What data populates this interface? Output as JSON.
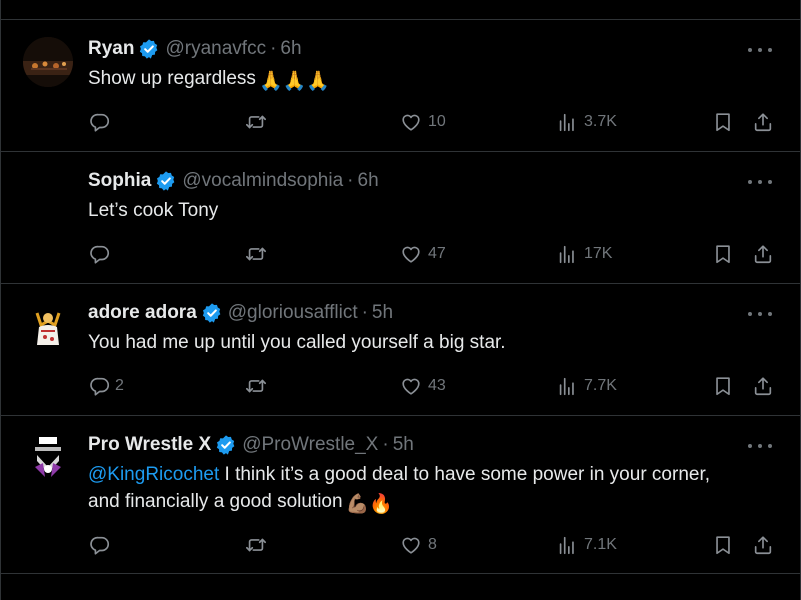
{
  "tweets": [
    {
      "name": "Ryan",
      "handle": "@ryanavfcc",
      "sep": "·",
      "time": "6h",
      "text": "Show up regardless",
      "emoji": "🙏🙏🙏",
      "replies": "",
      "likes": "10",
      "views": "3.7K"
    },
    {
      "name": "Sophia",
      "handle": "@vocalmindsophia",
      "sep": "·",
      "time": "6h",
      "text": "Let’s cook Tony",
      "replies": "",
      "likes": "47",
      "views": "17K"
    },
    {
      "name": "adore adora",
      "handle": "@gloriousafflict",
      "sep": "·",
      "time": "5h",
      "text": "You had me up until you called yourself a big star.",
      "replies": "2",
      "likes": "43",
      "views": "7.7K"
    },
    {
      "name": "Pro Wrestle X",
      "handle": "@ProWrestle_X",
      "sep": "·",
      "time": "5h",
      "mention": "@KingRicochet",
      "text_line1": " I think it’s a good deal to have some power in your corner,",
      "text_line2": "and financially a good solution",
      "emoji": "💪🏽🔥",
      "replies": "",
      "likes": "8",
      "views": "7.1K"
    }
  ],
  "colors": {
    "background": "#000000",
    "text": "#e7e9ea",
    "muted": "#71767b",
    "divider": "#2f3336",
    "accent": "#1d9bf0"
  },
  "icons": [
    "verified-badge-icon",
    "more-icon",
    "reply-icon",
    "retweet-icon",
    "like-icon",
    "views-icon",
    "bookmark-icon",
    "share-icon"
  ]
}
